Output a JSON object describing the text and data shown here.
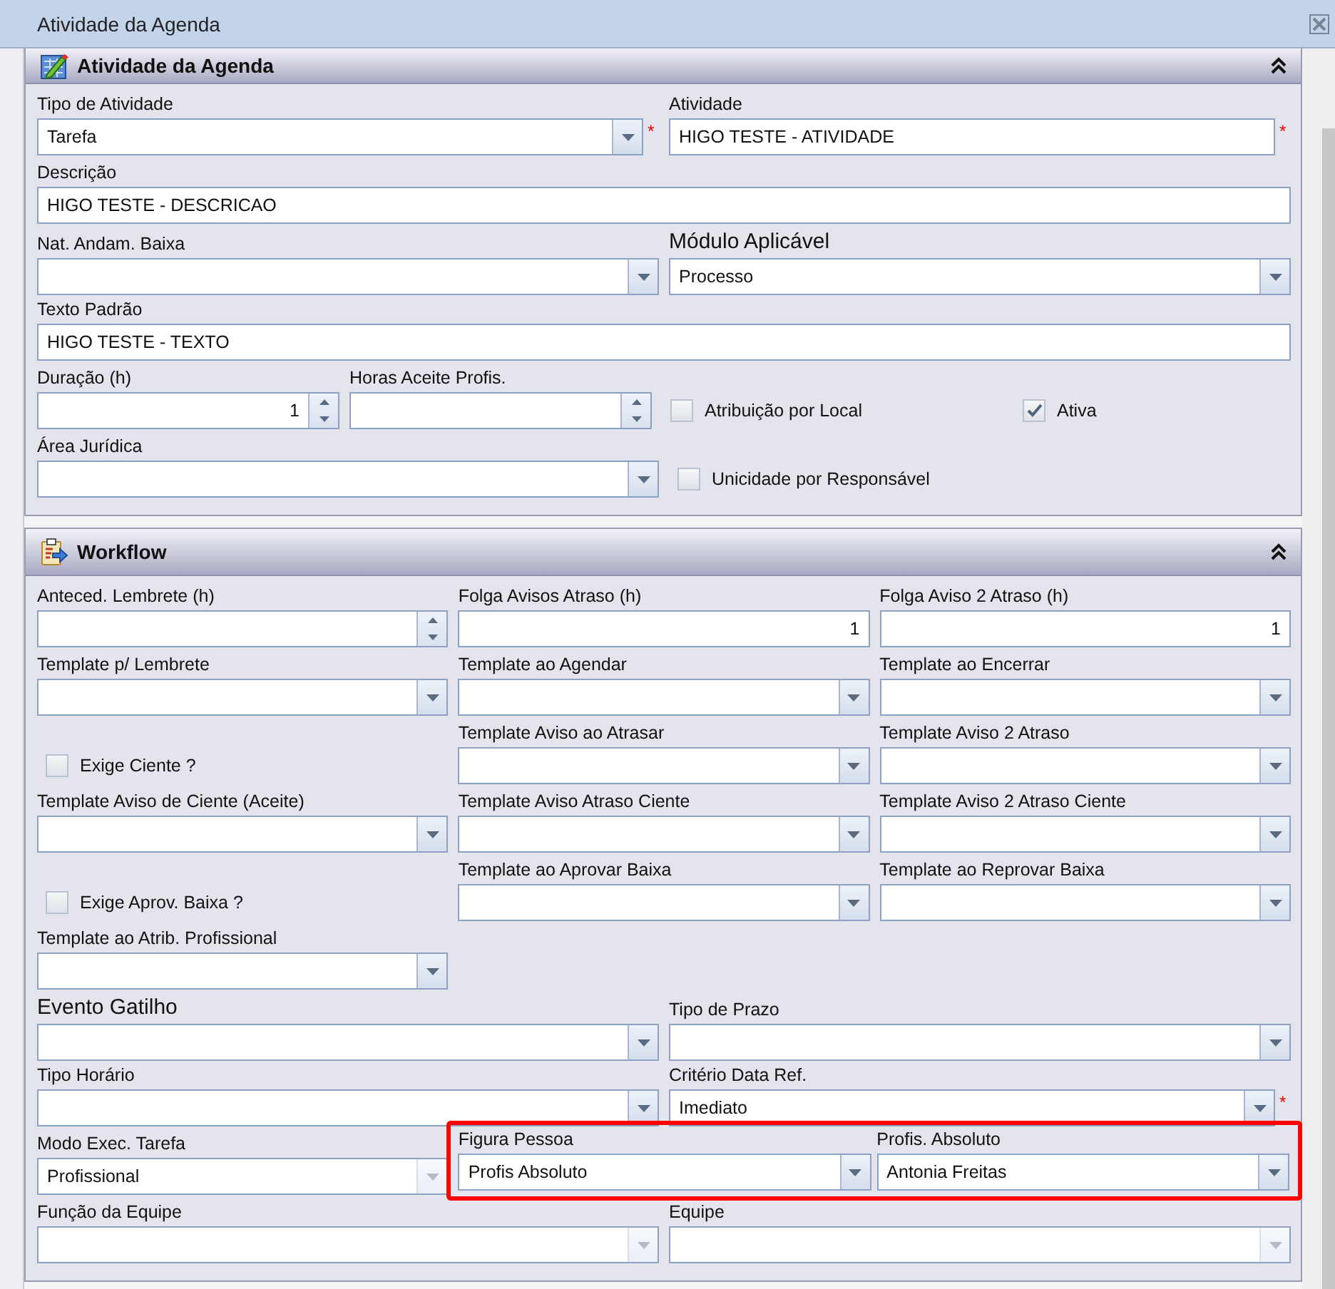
{
  "window": {
    "title": "Atividade da Agenda"
  },
  "sections": [
    {
      "title": "Atividade da Agenda",
      "expanded": true,
      "rows": [
        {
          "kind": "pair",
          "fields": [
            {
              "kind": "combo",
              "label": "Tipo de Atividade",
              "value": "Tarefa",
              "required": "*"
            },
            {
              "kind": "text",
              "label": "Atividade",
              "value": "HIGO TESTE - ATIVIDADE",
              "required": "*"
            }
          ]
        },
        {
          "kind": "full",
          "fields": [
            {
              "kind": "text",
              "label": "Descrição",
              "value": "HIGO TESTE - DESCRICAO"
            }
          ]
        },
        {
          "kind": "pair",
          "fields": [
            {
              "kind": "combo",
              "label": "Nat. Andam. Baixa"
            },
            {
              "kind": "combo",
              "label": "Módulo Aplicável",
              "value": "Processo",
              "large": true
            }
          ]
        },
        {
          "kind": "full",
          "fields": [
            {
              "kind": "text",
              "label": "Texto Padrão",
              "value": "HIGO TESTE - TEXTO"
            }
          ]
        },
        {
          "kind": "quad",
          "fields": [
            {
              "kind": "spinner",
              "label": "Duração (h)",
              "value": "1"
            },
            {
              "kind": "spinner",
              "label": "Horas Aceite Profis."
            },
            {
              "kind": "checkbox",
              "label": "Atribuição por Local",
              "checked": false
            },
            {
              "kind": "checkbox",
              "label": "Ativa",
              "checked": true
            }
          ]
        },
        {
          "kind": "pair",
          "fields": [
            {
              "kind": "combo",
              "label": "Área Jurídica"
            },
            {
              "kind": "checkbox",
              "label": "Unicidade por Responsável",
              "checked": false
            }
          ]
        }
      ]
    },
    {
      "title": "Workflow",
      "expanded": true,
      "rows": [
        {
          "kind": "triple",
          "fields": [
            {
              "kind": "spinner",
              "label": "Anteced. Lembrete (h)"
            },
            {
              "kind": "number",
              "label": "Folga Avisos Atraso (h)",
              "value": "1"
            },
            {
              "kind": "number",
              "label": "Folga Aviso 2 Atraso (h)",
              "value": "1"
            }
          ]
        },
        {
          "kind": "triple",
          "fields": [
            {
              "kind": "combo",
              "label": "Template p/ Lembrete"
            },
            {
              "kind": "combo",
              "label": "Template ao Agendar"
            },
            {
              "kind": "combo",
              "label": "Template ao Encerrar"
            }
          ]
        },
        {
          "kind": "triple",
          "fields": [
            {
              "kind": "checkbox",
              "label": "Exige Ciente ?",
              "checked": false
            },
            {
              "kind": "combo",
              "label": "Template Aviso ao Atrasar"
            },
            {
              "kind": "combo",
              "label": "Template Aviso 2 Atraso"
            }
          ]
        },
        {
          "kind": "triple",
          "fields": [
            {
              "kind": "combo",
              "label": "Template Aviso de Ciente (Aceite)"
            },
            {
              "kind": "combo",
              "label": "Template Aviso Atraso Ciente"
            },
            {
              "kind": "combo",
              "label": "Template Aviso 2 Atraso Ciente"
            }
          ]
        },
        {
          "kind": "triple",
          "fields": [
            {
              "kind": "checkbox",
              "label": "Exige Aprov. Baixa ?",
              "checked": false
            },
            {
              "kind": "combo",
              "label": "Template ao Aprovar Baixa"
            },
            {
              "kind": "combo",
              "label": "Template ao Reprovar Baixa"
            }
          ]
        },
        {
          "kind": "triple",
          "fields": [
            {
              "kind": "combo",
              "label": "Template ao Atrib. Profissional"
            }
          ]
        },
        {
          "kind": "pair",
          "fields": [
            {
              "kind": "combo",
              "label": "Evento Gatilho",
              "large": true
            },
            {
              "kind": "combo",
              "label": "Tipo de Prazo"
            }
          ]
        },
        {
          "kind": "pair",
          "fields": [
            {
              "kind": "combo",
              "label": "Tipo Horário"
            },
            {
              "kind": "combo",
              "label": "Critério Data Ref.",
              "value": "Imediato",
              "required": "*"
            }
          ]
        },
        {
          "kind": "triple",
          "fields": [
            {
              "kind": "combo",
              "label": "Modo Exec. Tarefa",
              "value": "Profissional",
              "disabled": true
            },
            {
              "kind": "combo",
              "label": "Figura Pessoa",
              "value": "Profis Absoluto",
              "highlighted": true
            },
            {
              "kind": "combo",
              "label": "Profis. Absoluto",
              "value": "Antonia Freitas",
              "highlighted": true
            }
          ]
        },
        {
          "kind": "pair",
          "fields": [
            {
              "kind": "combo",
              "label": "Função da Equipe",
              "disabled": true
            },
            {
              "kind": "combo",
              "label": "Equipe",
              "disabled": true
            }
          ]
        }
      ]
    }
  ]
}
